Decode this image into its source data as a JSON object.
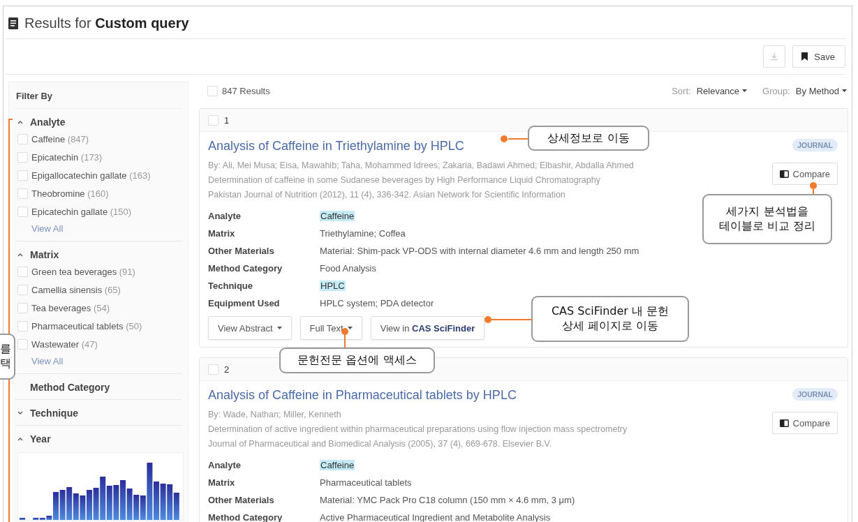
{
  "header": {
    "title": "Results for **Custom query**"
  },
  "toolbar": {
    "download": {
      "disabled": true
    },
    "save": "Save"
  },
  "filter": {
    "title": "Filter By",
    "sections": [
      {
        "label": "Analyte",
        "expanded": true,
        "options": [
          {
            "label": "Caffeine",
            "count": "(847)",
            "checked": false
          },
          {
            "label": "Epicatechin",
            "count": "(173)",
            "checked": false
          },
          {
            "label": "Epigallocatechin gallate",
            "count": "(163)",
            "checked": false
          },
          {
            "label": "Theobromine",
            "count": "(160)",
            "checked": false
          },
          {
            "label": "Epicatechin gallate",
            "count": "(150)",
            "checked": false
          }
        ],
        "view_all": "View All"
      },
      {
        "label": "Matrix",
        "expanded": true,
        "options": [
          {
            "label": "Green tea beverages",
            "count": "(91)",
            "checked": false
          },
          {
            "label": "Camellia sinensis",
            "count": "(65)",
            "checked": false
          },
          {
            "label": "Tea beverages",
            "count": "(54)",
            "checked": false
          },
          {
            "label": "Pharmaceutical tablets",
            "count": "(50)",
            "checked": false
          },
          {
            "label": "Wastewater",
            "count": "(47)",
            "checked": false
          }
        ],
        "view_all": "View All"
      },
      {
        "label": "Method Category"
      },
      {
        "label": "Technique",
        "expanded": false
      },
      {
        "label": "Year",
        "expanded": true,
        "histogram": true
      }
    ]
  },
  "results_bar": {
    "count": "847 Results",
    "checked": false,
    "sort_label": "Sort:",
    "sort_value": "Relevance",
    "group_label": "Group:",
    "group_value": "By Method"
  },
  "results": [
    {
      "number": "1",
      "checked": false,
      "title": "Analysis of Caffeine in Triethylamine by HPLC",
      "byline": "By: Ali, Mei Musa; Eisa, Mawahib; Taha, Mohammed Idrees; Zakaria, Badawi Ahmed; Elbashir, Abdalla Ahmed",
      "description": "Determination of caffeine in some Sudanese beverages by High Performance Liquid Chromatography",
      "source": "Pakistan Journal of Nutrition (2012), 11 (4), 336-342. Asian Network for Scientific Information",
      "badge": "JOURNAL",
      "compare": "Compare",
      "fields": [
        {
          "label": "Analyte",
          "value": "Caffeine",
          "highlight": true
        },
        {
          "label": "Matrix",
          "value": "Triethylamine; Coffea",
          "highlight": false
        },
        {
          "label": "Other Materials",
          "value": "Material: Shim-pack VP-ODS with internal diameter 4.6 mm and length 250 mm",
          "highlight": false
        },
        {
          "label": "Method Category",
          "value": "Food Analysis",
          "highlight": false
        },
        {
          "label": "Technique",
          "value": "HPLC",
          "highlight": true
        },
        {
          "label": "Equipment Used",
          "value": "HPLC system; PDA detector",
          "highlight": false
        }
      ],
      "actions": [
        {
          "label": "View Abstract",
          "dropdown": true
        },
        {
          "label": "Full Text",
          "dropdown": true
        },
        {
          "label": "View in **CAS SciFinder**",
          "dropdown": false
        }
      ]
    },
    {
      "number": "2",
      "checked": false,
      "title": "Analysis of Caffeine in Pharmaceutical tablets by HPLC",
      "byline": "By: Wade, Nathan; Miller, Kenneth",
      "description": "Determination of active ingredient within pharmaceutical preparations using flow injection mass spectrometry",
      "source": "Journal of Pharmaceutical and Biomedical Analysis (2005), 37 (4), 669-678. Elsevier B.V.",
      "badge": "JOURNAL",
      "compare": "Compare",
      "fields": [
        {
          "label": "Analyte",
          "value": "Caffeine",
          "highlight": true
        },
        {
          "label": "Matrix",
          "value": "Pharmaceutical tablets",
          "highlight": false
        },
        {
          "label": "Other Materials",
          "value": "Material: YMC Pack Pro C18 column (150 mm × 4.6 mm, 3 μm)",
          "highlight": false
        },
        {
          "label": "Method Category",
          "value": "Active Pharmaceutical Ingredient and Metabolite Analysis",
          "highlight": false
        }
      ]
    }
  ],
  "callouts": [
    {
      "text": "상세정보로 이동"
    },
    {
      "text": "세가지 분석법을\n테이블로 비교 정리"
    },
    {
      "text": "CAS SciFinder 내 문헌\n상세 페이지로 이동"
    },
    {
      "text": "를\n택"
    },
    {
      "text": "문헌전문 옵션에 액세스"
    }
  ]
}
